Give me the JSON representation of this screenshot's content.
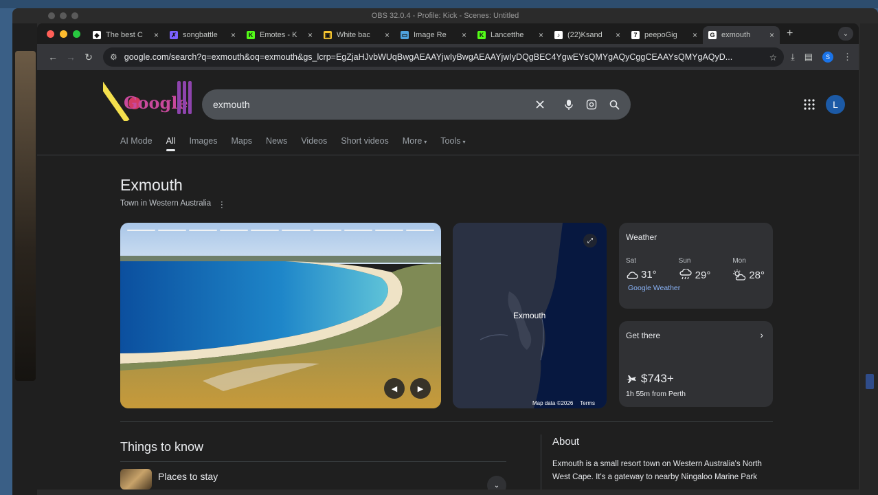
{
  "os": {
    "obs_title": "OBS 32.0.4 - Profile: Kick - Scenes: Untitled"
  },
  "browser": {
    "tabs": [
      {
        "title": "The best C",
        "favicon_color": "#ffffff",
        "favicon_glyph": "◆"
      },
      {
        "title": "songbattle",
        "favicon_color": "#7b61ff",
        "favicon_glyph": "✗"
      },
      {
        "title": "Emotes - K",
        "favicon_color": "#53fc18",
        "favicon_glyph": "K"
      },
      {
        "title": "White bac",
        "favicon_color": "#f4c430",
        "favicon_glyph": "▣"
      },
      {
        "title": "Image Re",
        "favicon_color": "#4fa3e0",
        "favicon_glyph": "▭"
      },
      {
        "title": "Lancetthe",
        "favicon_color": "#53fc18",
        "favicon_glyph": "K"
      },
      {
        "title": "(22)Ksand",
        "favicon_color": "#ffffff",
        "favicon_glyph": "♪"
      },
      {
        "title": "peepoGig",
        "favicon_color": "#ffffff",
        "favicon_glyph": "7"
      },
      {
        "title": "exmouth",
        "favicon_color": "#ffffff",
        "favicon_glyph": "G",
        "active": true
      }
    ],
    "new_tab": "+",
    "url": "google.com/search?q=exmouth&oq=exmouth&gs_lcrp=EgZjaHJvbWUqBwgAEAAYjwIyBwgAEAAYjwIyDQgBEC4YgwEYsQMYgAQyCggCEAAYsQMYgAQyD..."
  },
  "google": {
    "query": "exmouth",
    "profile_initial": "L",
    "nav_tabs": [
      "AI Mode",
      "All",
      "Images",
      "Maps",
      "News",
      "Videos",
      "Short videos",
      "More",
      "Tools"
    ],
    "active_tab": "All",
    "entity": {
      "title": "Exmouth",
      "subtitle": "Town in Western Australia"
    },
    "map": {
      "label": "Exmouth",
      "credit": "Map data ©2026",
      "terms": "Terms"
    },
    "weather": {
      "heading": "Weather",
      "days": [
        {
          "day": "Sat",
          "temp": "31°",
          "icon": "cloud-icon"
        },
        {
          "day": "Sun",
          "temp": "29°",
          "icon": "rain-icon"
        },
        {
          "day": "Mon",
          "temp": "28°",
          "icon": "partly-sunny-icon"
        }
      ],
      "link": "Google Weather"
    },
    "get_there": {
      "heading": "Get there",
      "price": "$743+",
      "duration": "1h 55m from Perth"
    },
    "things_to_know": {
      "heading": "Things to know",
      "item": "Places to stay"
    },
    "about": {
      "heading": "About",
      "text": "Exmouth is a small resort town on Western Australia's North West Cape. It's a gateway to nearby Ningaloo Marine Park"
    }
  }
}
